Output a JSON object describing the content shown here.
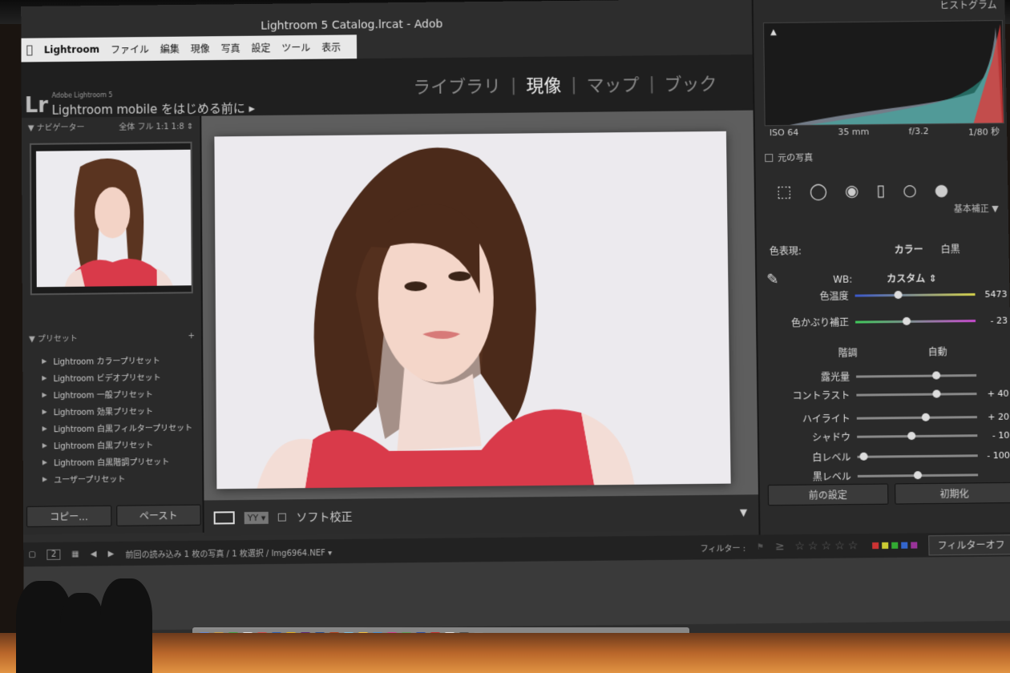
{
  "menubar": {
    "app": "Lightroom",
    "items": [
      "ファイル",
      "編集",
      "現像",
      "写真",
      "設定",
      "ツール",
      "表示"
    ]
  },
  "window": {
    "title": "Lightroom 5 Catalog.lrcat - Adob"
  },
  "header": {
    "logo": "Lr",
    "adobe": "Adobe Lightroom 5",
    "mobile": "Lightroom mobile をはじめる前に ▸"
  },
  "modules": [
    {
      "label": "ライブラリ",
      "active": false
    },
    {
      "label": "現像",
      "active": true
    },
    {
      "label": "マップ",
      "active": false
    },
    {
      "label": "ブック",
      "active": false
    }
  ],
  "navigator": {
    "title": "▼ ナビゲーター",
    "zoom": "全体  フル  1:1  1:8 ⇕"
  },
  "presets": {
    "title": "▼ プリセット",
    "add": "+",
    "items": [
      "Lightroom カラープリセット",
      "Lightroom ビデオプリセット",
      "Lightroom 一般プリセット",
      "Lightroom 効果プリセット",
      "Lightroom 白黒フィルタープリセット",
      "Lightroom 白黒プリセット",
      "Lightroom 白黒階調プリセット",
      "ユーザープリセット"
    ]
  },
  "left_buttons": {
    "copy": "コピー...",
    "paste": "ペースト"
  },
  "toolbar": {
    "yy": "YY ▾",
    "soft_proof": "ソフト校正"
  },
  "right": {
    "histogram_label": "ヒストグラム",
    "exif": [
      "ISO 64",
      "35 mm",
      "f/3.2",
      "1/80 秒"
    ],
    "original": "元の写真",
    "section": "基本補正 ▼",
    "treatment_label": "色表現:",
    "color": "カラー",
    "bw": "白黒",
    "wb_label": "WB:",
    "wb_value": "カスタム ⇕",
    "sliders": [
      {
        "label": "色温度",
        "value": "5473",
        "pos": 0.35,
        "cls": "temp"
      },
      {
        "label": "色かぶり補正",
        "value": "- 23",
        "pos": 0.42,
        "cls": "tint"
      },
      {
        "label": "露光量",
        "value": "",
        "pos": 0.68,
        "cls": ""
      },
      {
        "label": "コントラスト",
        "value": "+ 40",
        "pos": 0.68,
        "cls": ""
      },
      {
        "label": "ハイライト",
        "value": "+ 20",
        "pos": 0.58,
        "cls": ""
      },
      {
        "label": "シャドウ",
        "value": "- 10",
        "pos": 0.45,
        "cls": ""
      },
      {
        "label": "白レベル",
        "value": "- 100",
        "pos": 0.02,
        "cls": ""
      },
      {
        "label": "黒レベル",
        "value": "",
        "pos": 0.5,
        "cls": ""
      }
    ],
    "tone_label": "階調",
    "auto": "自動",
    "prev_button": "前の設定",
    "reset_button": "初期化"
  },
  "filmbar": {
    "page": "2",
    "path": "前回の読み込み   1 枚の写真 / 1 枚選択 / Img6964.NEF ▾",
    "filter_label": "フィルター :",
    "stars": "≥ ☆☆☆☆☆",
    "filter_off": "フィルターオフ"
  },
  "colors": {
    "accent_red": "#d93a4a",
    "panel": "#2a2a2a",
    "photo_bg": "#eceaee"
  }
}
